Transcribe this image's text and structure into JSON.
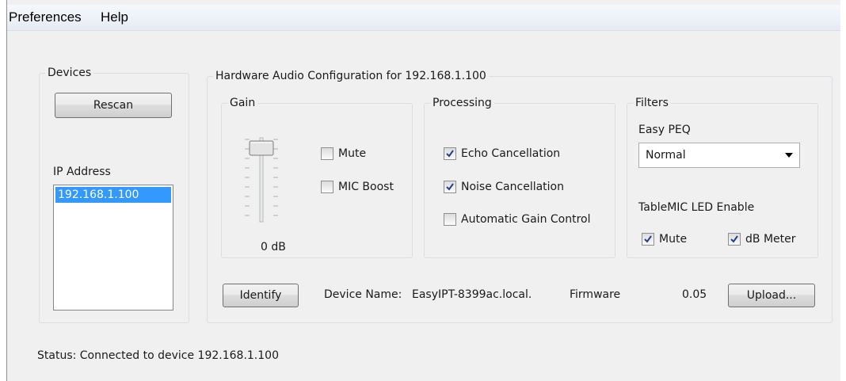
{
  "menu": {
    "items": [
      "Preferences",
      "Help"
    ]
  },
  "devices": {
    "legend": "Devices",
    "rescan_label": "Rescan",
    "ip_label": "IP Address",
    "ip_list": [
      "192.168.1.100"
    ]
  },
  "hardware": {
    "legend": "Hardware Audio Configuration for 192.168.1.100",
    "gain": {
      "legend": "Gain",
      "value_label": "0 dB",
      "mute": {
        "label": "Mute",
        "checked": false
      },
      "mic_boost": {
        "label": "MIC Boost",
        "checked": false
      }
    },
    "processing": {
      "legend": "Processing",
      "echo": {
        "label": "Echo Cancellation",
        "checked": true
      },
      "noise": {
        "label": "Noise Cancellation",
        "checked": true
      },
      "agc": {
        "label": "Automatic Gain Control",
        "checked": false
      }
    },
    "filters": {
      "legend": "Filters",
      "peq_label": "Easy PEQ",
      "peq_value": "Normal",
      "led_label": "TableMIC LED Enable",
      "led_mute": {
        "label": "Mute",
        "checked": true
      },
      "led_db": {
        "label": "dB Meter",
        "checked": true
      }
    },
    "identify_label": "Identify",
    "device_name_label": "Device Name:",
    "device_name_value": "EasyIPT-8399ac.local.",
    "firmware_label": "Firmware",
    "firmware_value": "0.05",
    "upload_label": "Upload..."
  },
  "status": {
    "label": "Status:",
    "text": "Connected to device 192.168.1.100"
  },
  "colors": {
    "selection": "#3399ff",
    "window_bg": "#f0f0f0",
    "group_border": "#d5dfe5"
  }
}
